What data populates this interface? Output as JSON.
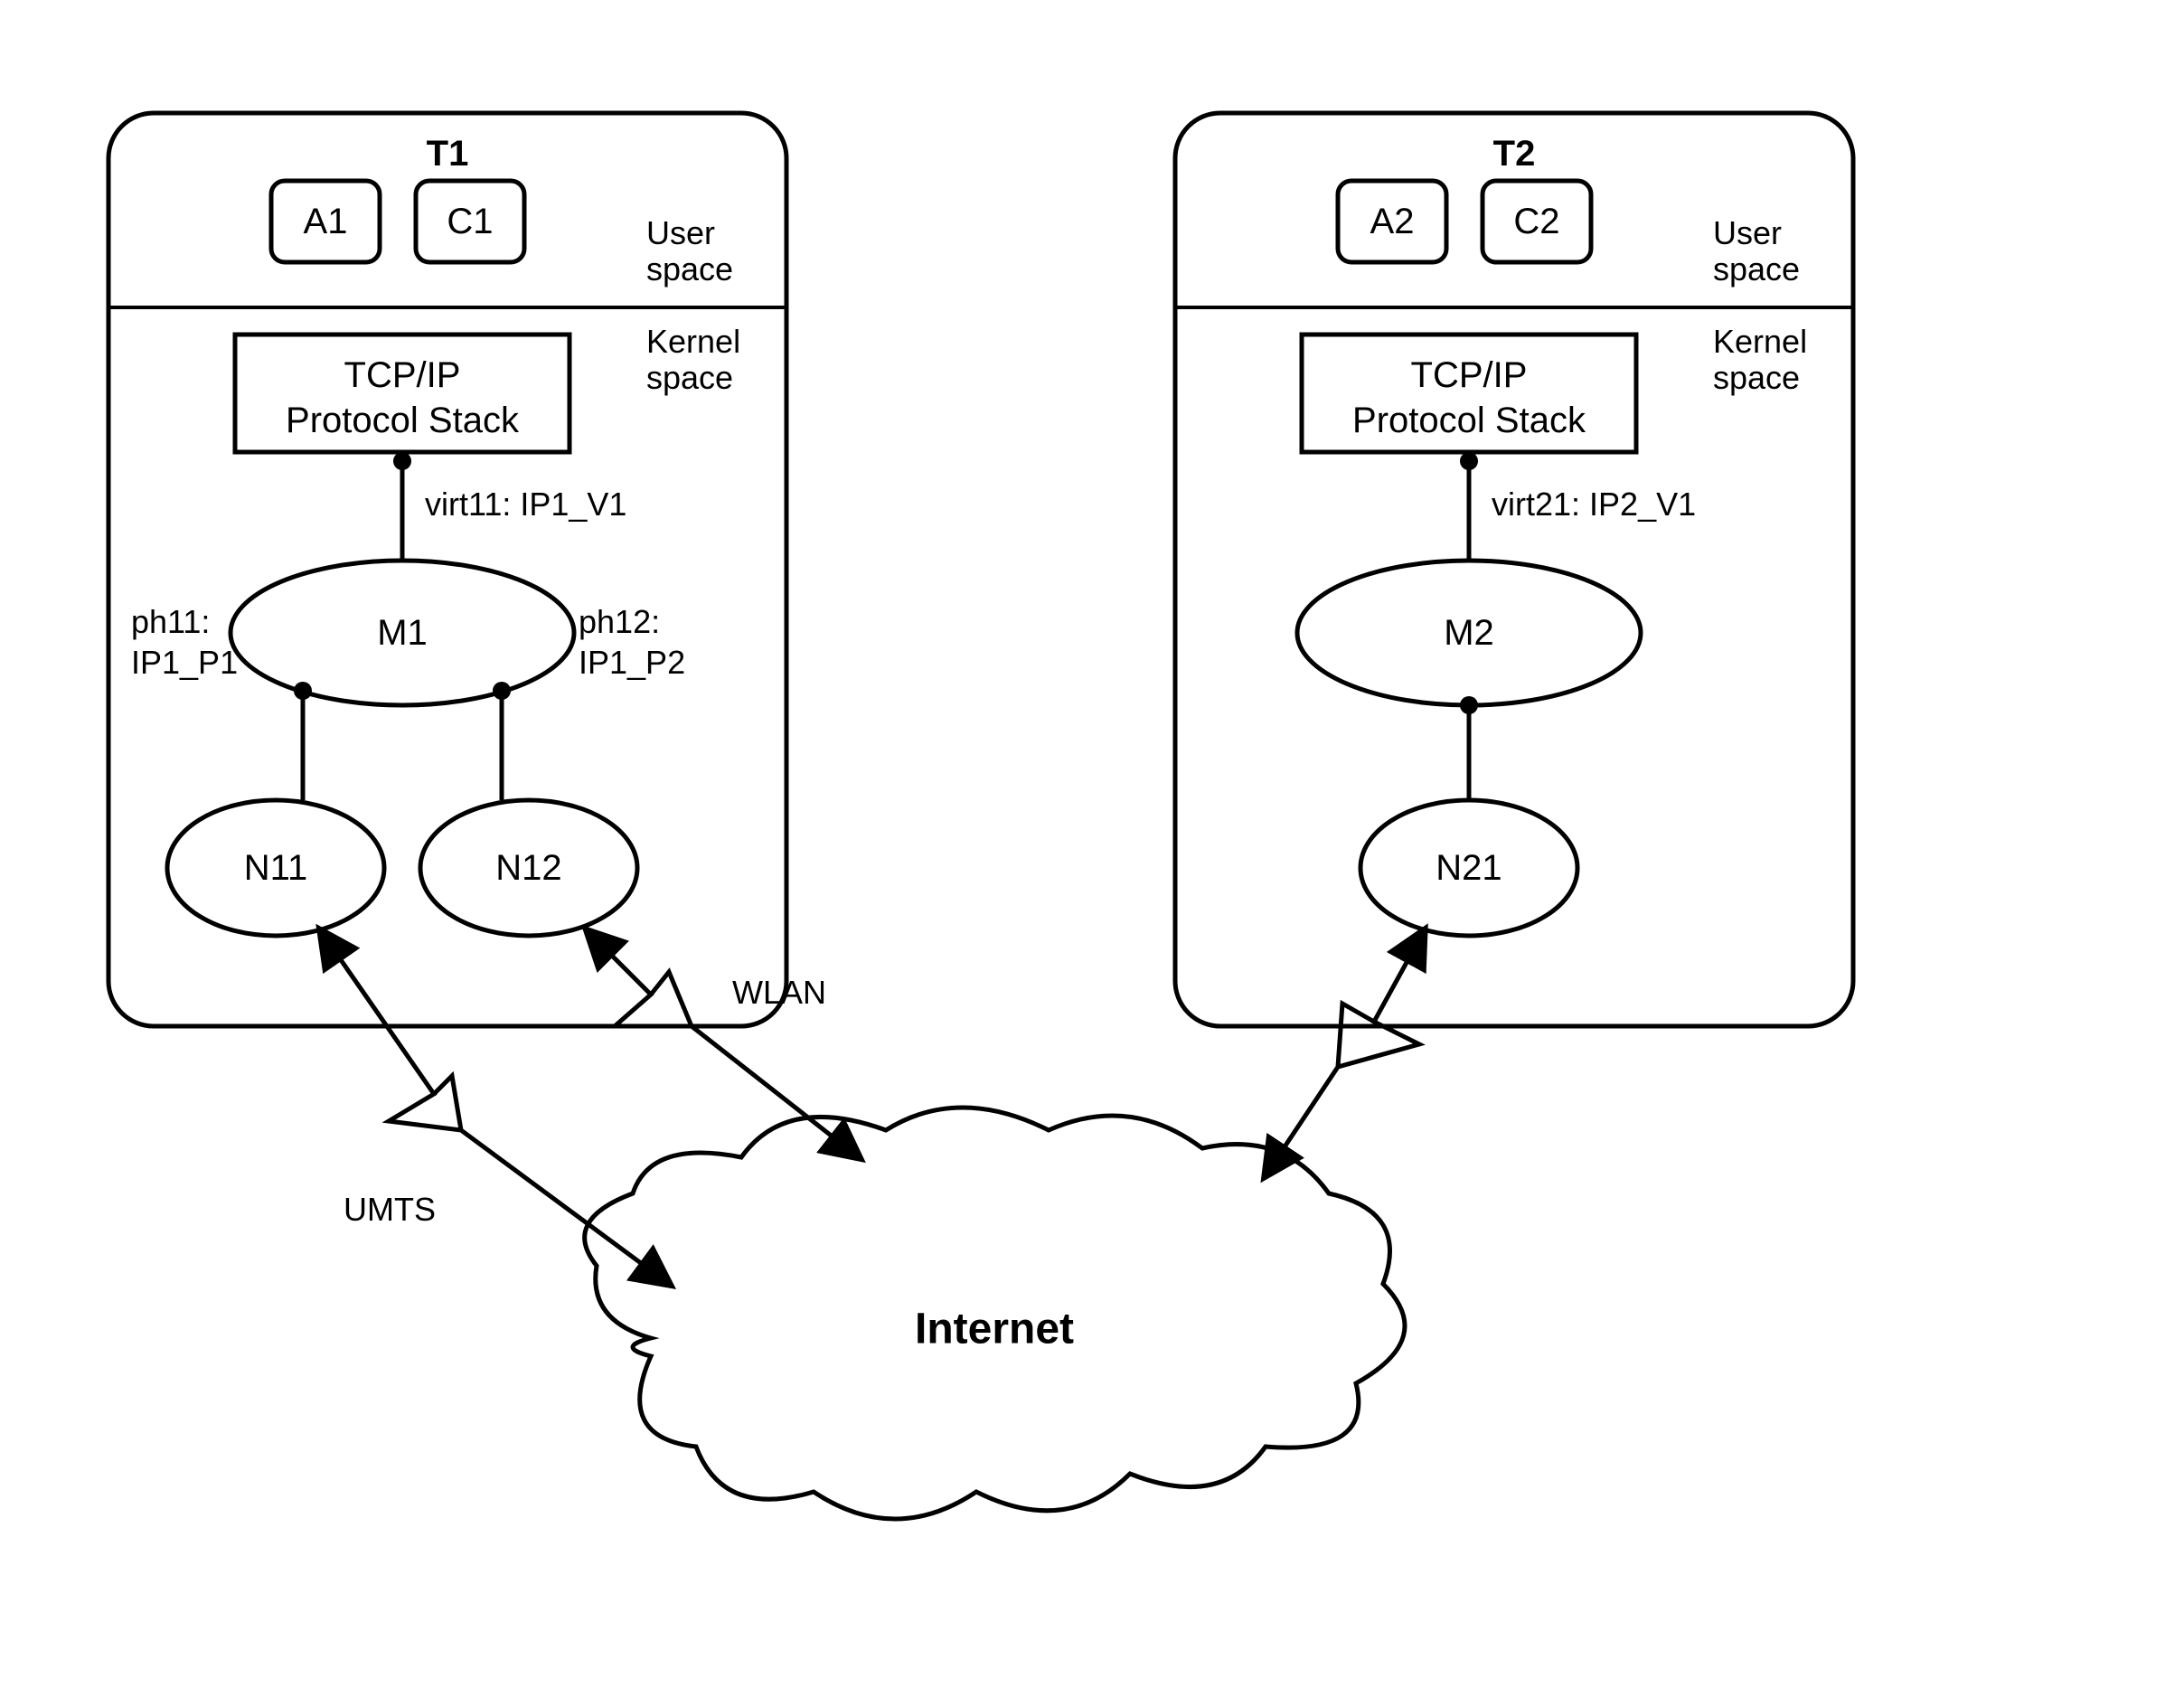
{
  "t1": {
    "title": "T1",
    "a_box": "A1",
    "c_box": "C1",
    "user_space": "User space",
    "kernel_space": "Kernel space",
    "stack_line1": "TCP/IP",
    "stack_line2": "Protocol Stack",
    "virt_label": "virt11: IP1_V1",
    "m_label": "M1",
    "ph1_line1": "ph11:",
    "ph1_line2": "IP1_P1",
    "ph2_line1": "ph12:",
    "ph2_line2": "IP1_P2",
    "n1_label": "N11",
    "n2_label": "N12"
  },
  "t2": {
    "title": "T2",
    "a_box": "A2",
    "c_box": "C2",
    "user_space": "User space",
    "kernel_space": "Kernel space",
    "stack_line1": "TCP/IP",
    "stack_line2": "Protocol Stack",
    "virt_label": "virt21: IP2_V1",
    "m_label": "M2",
    "n_label": "N21"
  },
  "network": {
    "umts": "UMTS",
    "wlan": "WLAN",
    "internet": "Internet"
  }
}
